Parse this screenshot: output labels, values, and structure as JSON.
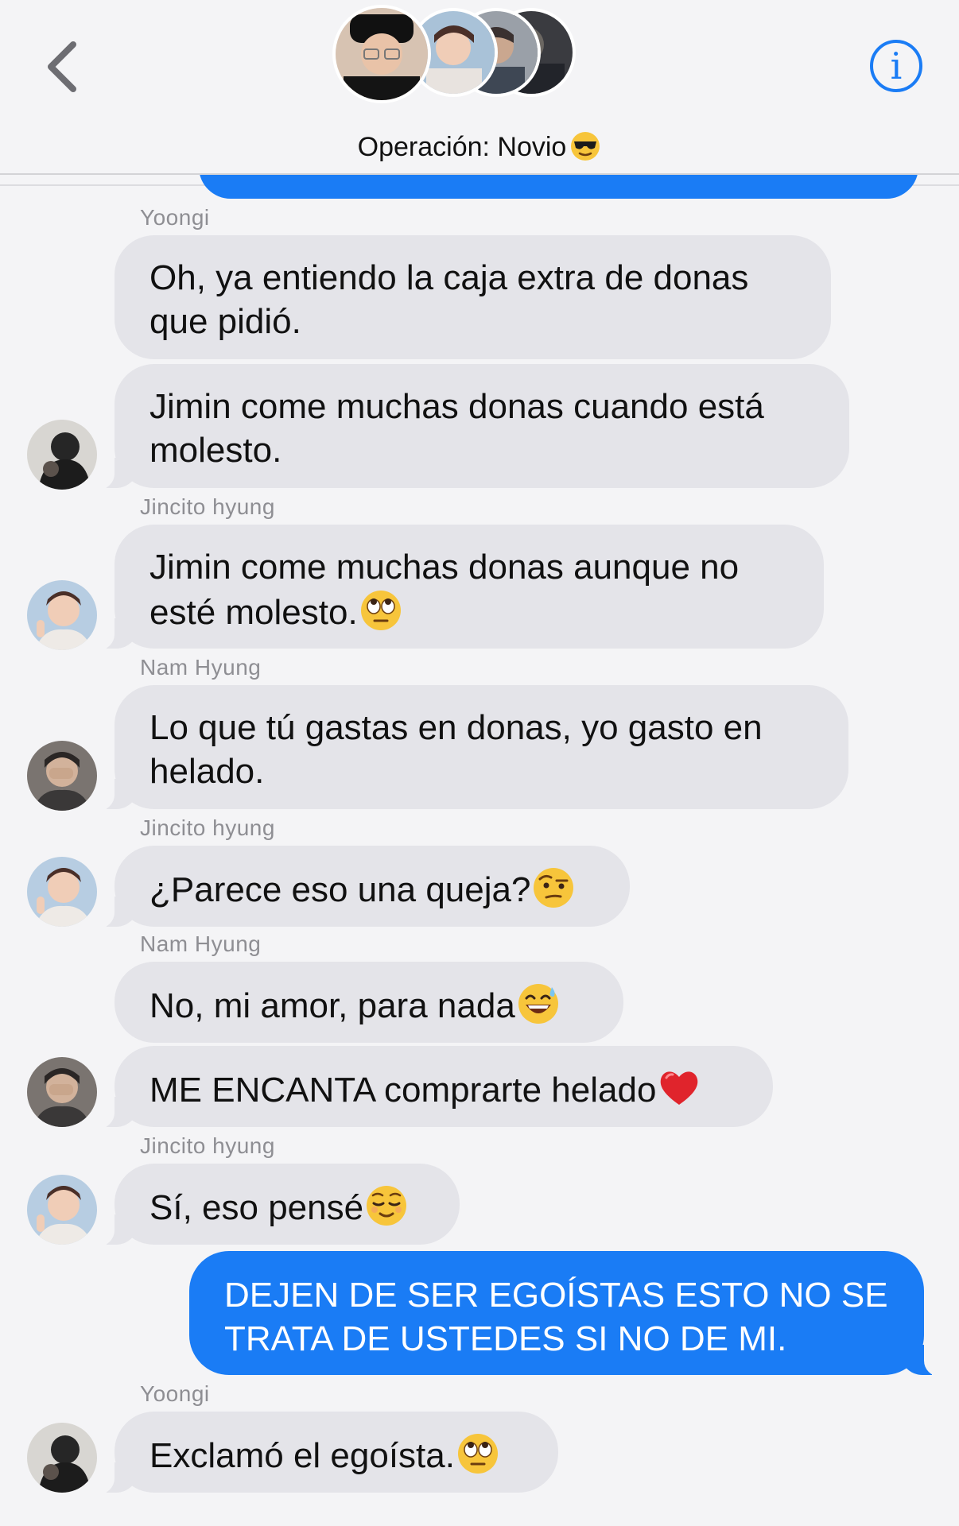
{
  "header": {
    "back_icon": "chevron-left-icon",
    "info_icon": "info-circle-icon",
    "info_label": "i",
    "group_name": "Operación: Novio",
    "group_emoji": "smiling-face-with-sunglasses",
    "accent": "#1a7cf5"
  },
  "colors": {
    "incoming_bubble": "#e4e4e9",
    "outgoing_bubble": "#1a7cf5",
    "sender_label": "#8e8e93",
    "background": "#f4f4f6"
  },
  "messages": [
    {
      "sender": "Yoongi",
      "text": "Oh, ya entiendo la caja extra de donas que pidió."
    },
    {
      "text": "Jimin come muchas donas cuando está molesto."
    },
    {
      "sender": "Jincito hyung",
      "text": "Jimin come muchas donas aunque no esté molesto.",
      "emoji": "face-with-rolling-eyes"
    },
    {
      "sender": "Nam Hyung",
      "text": "Lo que tú gastas en donas, yo gasto en helado."
    },
    {
      "sender": "Jincito hyung",
      "text": "¿Parece eso una queja?",
      "emoji": "face-with-raised-eyebrow"
    },
    {
      "sender": "Nam Hyung",
      "text": "No, mi amor, para nada",
      "emoji": "grinning-face-with-sweat"
    },
    {
      "text": "ME ENCANTA comprarte helado",
      "emoji": "red-heart"
    },
    {
      "sender": "Jincito hyung",
      "text": "Sí, eso pensé",
      "emoji": "relieved-face"
    },
    {
      "text": "DEJEN DE SER EGOÍSTAS ESTO NO SE TRATA DE USTEDES SI NO DE MI.",
      "outgoing": true
    },
    {
      "sender": "Yoongi",
      "text": "Exclamó el egoísta.",
      "emoji": "face-with-rolling-eyes"
    }
  ]
}
